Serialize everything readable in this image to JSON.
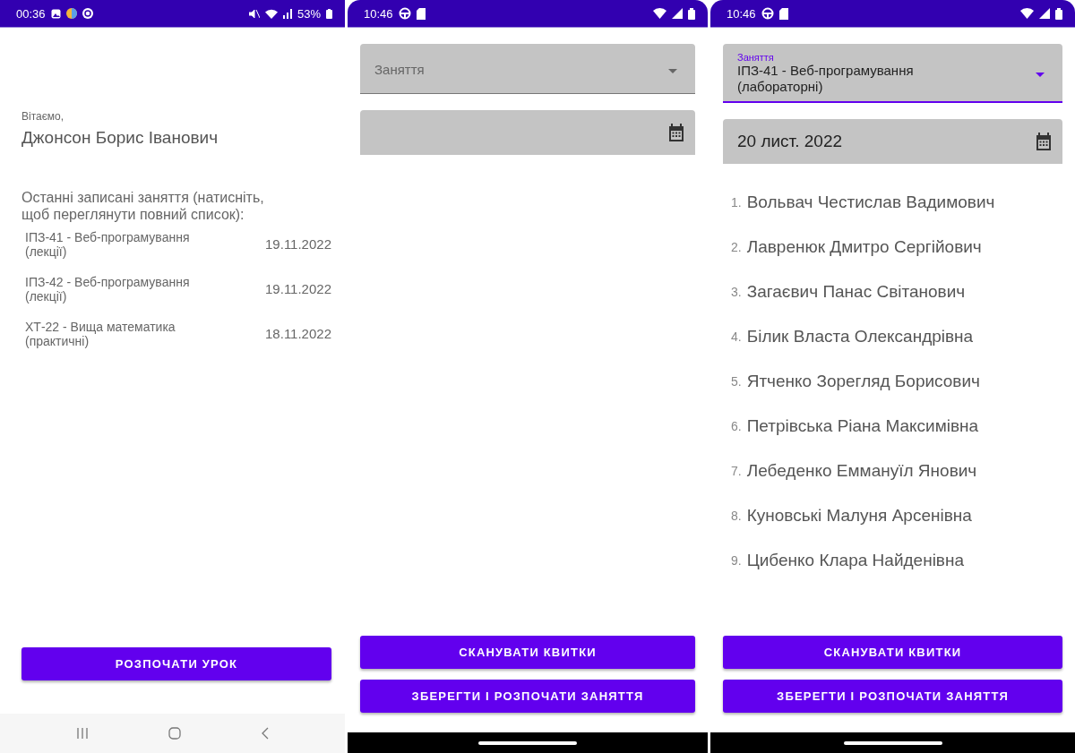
{
  "screens": [
    {
      "kind": "home",
      "status_bar": {
        "time": "00:36",
        "battery": "53%"
      },
      "greeting": "Вітаємо,",
      "user_name": "Джонсон Борис Іванович",
      "recent_heading": "Останні записані заняття (натисніть, щоб переглянути повний список):",
      "recent_lessons": [
        {
          "title": "ІПЗ-41 - Веб-програмування (лекції)",
          "date": "19.11.2022"
        },
        {
          "title": "ІПЗ-42 - Веб-програмування (лекції)",
          "date": "19.11.2022"
        },
        {
          "title": "ХТ-22 - Вища математика (практичні)",
          "date": "18.11.2022"
        }
      ],
      "buttons": [
        "РОЗПОЧАТИ УРОК"
      ],
      "nav_bar": {
        "kind": "buttons"
      }
    },
    {
      "kind": "lesson",
      "status_bar": {
        "time": "10:46"
      },
      "lesson_field": {
        "placeholder": "Заняття",
        "focused": false
      },
      "buttons": [
        "СКАНУВАТИ КВИТКИ",
        "ЗБЕРЕГТИ І РОЗПОЧАТИ ЗАНЯТТЯ"
      ],
      "nav_bar": {
        "kind": "gesture"
      }
    },
    {
      "kind": "lesson",
      "status_bar": {
        "time": "10:46"
      },
      "lesson_field": {
        "label": "Заняття",
        "value": "ІПЗ-41 - Веб-програмування (лабораторні)",
        "focused": true
      },
      "date_field": {
        "value": "20 лист. 2022"
      },
      "students": [
        {
          "number": "1.",
          "name": "Вольвач Честислав Вадимович"
        },
        {
          "number": "2.",
          "name": "Лавренюк Дмитро Сергійович"
        },
        {
          "number": "3.",
          "name": "Загаєвич Панас Світанович"
        },
        {
          "number": "4.",
          "name": "Білик Власта Олександрівна"
        },
        {
          "number": "5.",
          "name": "Ятченко Зорегляд Борисович"
        },
        {
          "number": "6.",
          "name": "Петрівська Ріана Максимівна"
        },
        {
          "number": "7.",
          "name": "Лебеденко Еммануїл Янович"
        },
        {
          "number": "8.",
          "name": "Куновські Малуня Арсенівна"
        },
        {
          "number": "9.",
          "name": "Цибенко Клара Найденівна"
        }
      ],
      "buttons": [
        "СКАНУВАТИ КВИТКИ",
        "ЗБЕРЕГТИ І РОЗПОЧАТИ ЗАНЯТТЯ"
      ],
      "nav_bar": {
        "kind": "gesture"
      }
    }
  ]
}
